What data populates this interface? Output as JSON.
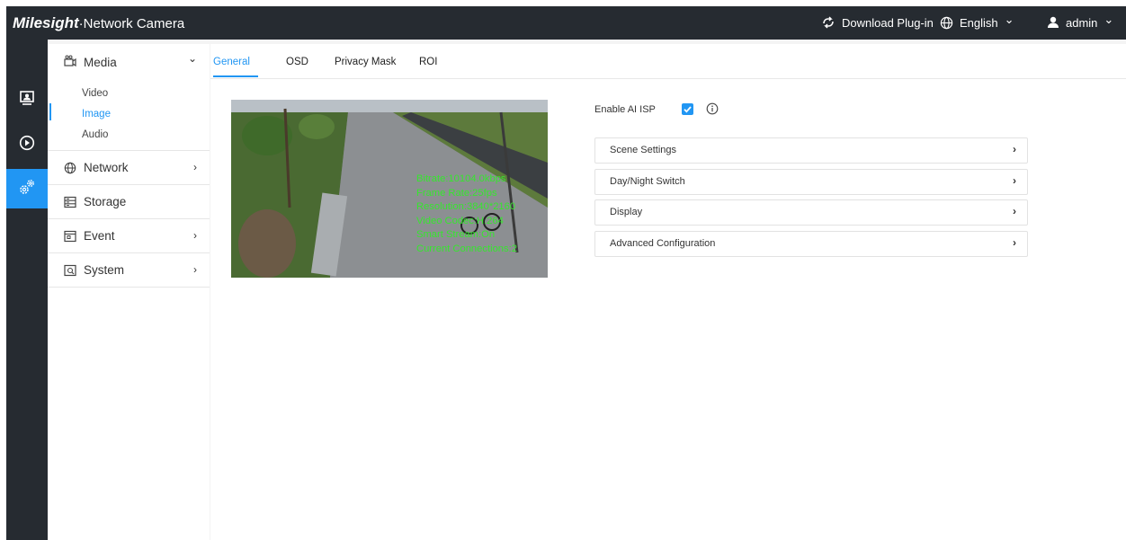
{
  "header": {
    "brand_logo": "Milesight",
    "brand_sep": "·",
    "brand_name": "Network Camera",
    "download_label": "Download Plug-in",
    "language_label": "English",
    "user_label": "admin",
    "chevron": "⌄"
  },
  "iconbar": {
    "items": [
      {
        "name": "live-view",
        "icon": "monitor-icon"
      },
      {
        "name": "playback",
        "icon": "play-circle-icon"
      },
      {
        "name": "settings",
        "icon": "gears-icon",
        "active": true
      }
    ]
  },
  "sidebar": {
    "media": {
      "label": "Media",
      "arrow": "⌄",
      "icon": "camera-icon"
    },
    "media_sub": [
      "Video",
      "Image",
      "Audio"
    ],
    "active_sub": "Image",
    "network": {
      "label": "Network",
      "arrow": "›",
      "icon": "globe-icon"
    },
    "storage": {
      "label": "Storage",
      "icon": "storage-icon"
    },
    "event": {
      "label": "Event",
      "arrow": "›",
      "icon": "event-icon"
    },
    "system": {
      "label": "System",
      "arrow": "›",
      "icon": "system-icon"
    }
  },
  "tabs": [
    {
      "label": "General",
      "active": true
    },
    {
      "label": "OSD"
    },
    {
      "label": "Privacy Mask"
    },
    {
      "label": "ROI"
    }
  ],
  "video": {
    "overlay": [
      "Bitrate:10104.0kbps",
      "Frame Rate:25fps",
      "Resolution:3840*2160",
      "Video Codec:H.264",
      "Smart Stream:On",
      "Current Connections:2"
    ]
  },
  "settings": {
    "ai_isp_label": "Enable AI ISP",
    "ai_isp_checked": true,
    "panels": [
      {
        "label": "Scene Settings",
        "arrow": "›"
      },
      {
        "label": "Day/Night Switch",
        "arrow": "›"
      },
      {
        "label": "Display",
        "arrow": "›"
      },
      {
        "label": "Advanced Configuration",
        "arrow": "›"
      }
    ]
  },
  "colors": {
    "topbar": "#262b31",
    "accent": "#2196f3",
    "overlay_text": "#36e62e"
  }
}
